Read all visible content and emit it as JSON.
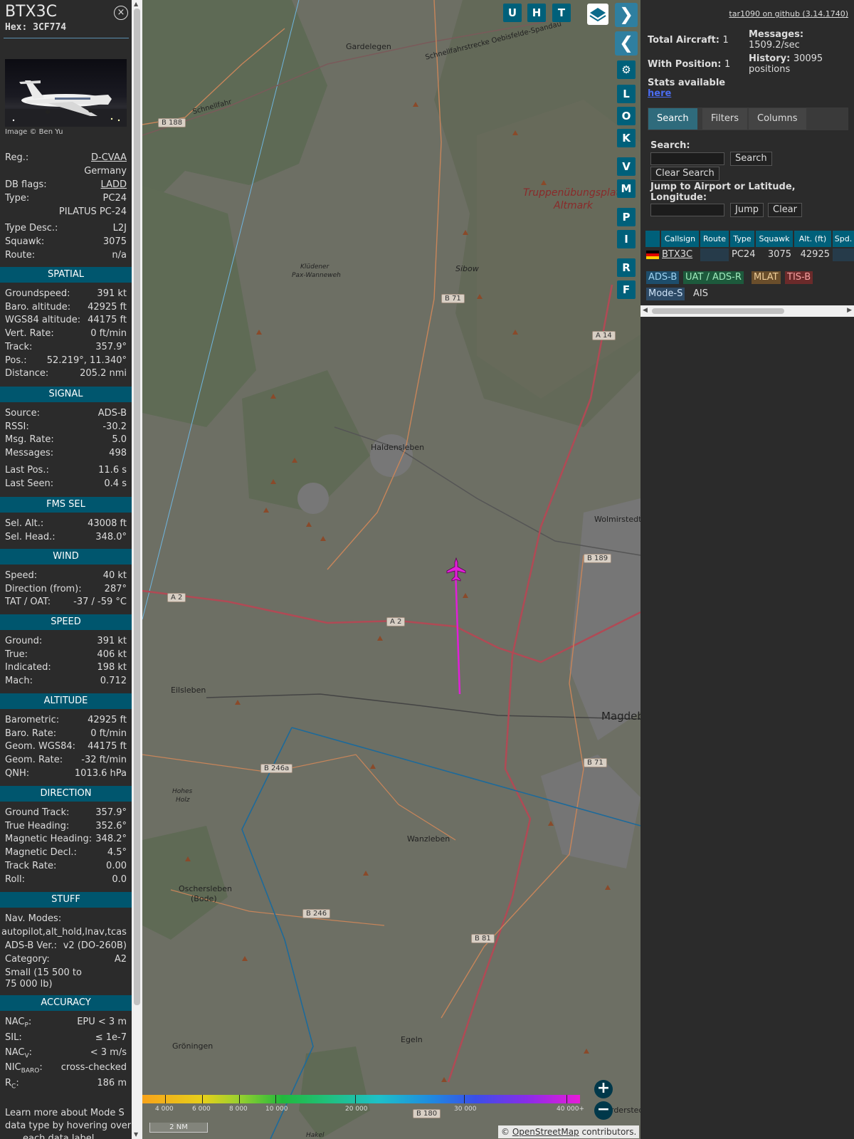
{
  "aircraft": {
    "title": "BTX3C",
    "hex": "Hex: 3CF774",
    "image_credit": "Image © Ben Yu",
    "close": "×"
  },
  "info": {
    "reg_label": "Reg.:",
    "reg_value": "D-CVAA",
    "country": "Germany",
    "dbflags_label": "DB flags:",
    "dbflags_value": "LADD",
    "type_label": "Type:",
    "type_value": "PC24",
    "type_name": "PILATUS PC-24",
    "typedesc_label": "Type Desc.:",
    "typedesc_value": "L2J",
    "squawk_label": "Squawk:",
    "squawk_value": "3075",
    "route_label": "Route:",
    "route_value": "n/a"
  },
  "sections": {
    "spatial": "SPATIAL",
    "signal": "SIGNAL",
    "fms": "FMS SEL",
    "wind": "WIND",
    "speed": "SPEED",
    "altitude": "ALTITUDE",
    "direction": "DIRECTION",
    "stuff": "STUFF",
    "accuracy": "ACCURACY"
  },
  "spatial": [
    {
      "k": "Groundspeed:",
      "v": "391 kt"
    },
    {
      "k": "Baro. altitude:",
      "v": "42925 ft"
    },
    {
      "k": "WGS84 altitude:",
      "v": "44175 ft"
    },
    {
      "k": "Vert. Rate:",
      "v": "0 ft/min"
    },
    {
      "k": "Track:",
      "v": "357.9°"
    },
    {
      "k": "Pos.:",
      "v": "52.219°, 11.340°"
    },
    {
      "k": "Distance:",
      "v": "205.2 nmi"
    }
  ],
  "signal": [
    {
      "k": "Source:",
      "v": "ADS-B"
    },
    {
      "k": "RSSI:",
      "v": "-30.2"
    },
    {
      "k": "Msg. Rate:",
      "v": "5.0"
    },
    {
      "k": "Messages:",
      "v": "498"
    },
    {
      "k": "Last Pos.:",
      "v": "11.6 s"
    },
    {
      "k": "Last Seen:",
      "v": "0.4 s"
    }
  ],
  "fms": [
    {
      "k": "Sel. Alt.:",
      "v": "43008 ft"
    },
    {
      "k": "Sel. Head.:",
      "v": "348.0°"
    }
  ],
  "wind": [
    {
      "k": "Speed:",
      "v": "40 kt"
    },
    {
      "k": "Direction (from):",
      "v": "287°"
    },
    {
      "k": "TAT / OAT:",
      "v": "-37 / -59 °C"
    }
  ],
  "speed": [
    {
      "k": "Ground:",
      "v": "391 kt"
    },
    {
      "k": "True:",
      "v": "406 kt"
    },
    {
      "k": "Indicated:",
      "v": "198 kt"
    },
    {
      "k": "Mach:",
      "v": "0.712"
    }
  ],
  "altitude": [
    {
      "k": "Barometric:",
      "v": "42925 ft"
    },
    {
      "k": "Baro. Rate:",
      "v": "0 ft/min"
    },
    {
      "k": "Geom. WGS84:",
      "v": "44175 ft"
    },
    {
      "k": "Geom. Rate:",
      "v": "-32 ft/min"
    },
    {
      "k": "QNH:",
      "v": "1013.6 hPa"
    }
  ],
  "direction": [
    {
      "k": "Ground Track:",
      "v": "357.9°"
    },
    {
      "k": "True Heading:",
      "v": "352.6°"
    },
    {
      "k": "Magnetic Heading:",
      "v": "348.2°"
    },
    {
      "k": "Magnetic Decl.:",
      "v": "4.5°"
    },
    {
      "k": "Track Rate:",
      "v": "0.00"
    },
    {
      "k": "Roll:",
      "v": "0.0"
    }
  ],
  "stuff": {
    "navmodes_label": "Nav. Modes:",
    "navmodes_value": "autopilot,alt_hold,lnav,tcas",
    "adsbver_label": "ADS-B Ver.:",
    "adsbver_value": "v2 (DO-260B)",
    "category_label": "Category:",
    "category_value": "A2",
    "category_desc_1": "Small (15 500 to",
    "category_desc_2": "75 000 lb)"
  },
  "accuracy": [
    {
      "k": "NAC",
      "sub": "P",
      "tail": ":",
      "v": "EPU < 3 m"
    },
    {
      "k": "SIL:",
      "sub": "",
      "tail": "",
      "v": "≤ 1e-7"
    },
    {
      "k": "NAC",
      "sub": "V",
      "tail": ":",
      "v": "< 3 m/s"
    },
    {
      "k": "NIC",
      "sub": "BARO",
      "tail": ":",
      "v": "cross-checked"
    },
    {
      "k": "R",
      "sub": "C",
      "tail": ":",
      "v": "186 m"
    }
  ],
  "learn_more": [
    "Learn more about Mode S",
    "data type by hovering over",
    "each data label"
  ],
  "map": {
    "toolbar": [
      "U",
      "H",
      "T"
    ],
    "side_buttons": [
      "L",
      "O",
      "K",
      "V",
      "M",
      "P",
      "I",
      "R",
      "F"
    ],
    "place_labels": [
      {
        "t": "Gardelegen"
      },
      {
        "t": "Haldensleben"
      },
      {
        "t": "Truppenübungsplatz"
      },
      {
        "t": "Altmark"
      },
      {
        "t": "Sibow"
      },
      {
        "t": "Klüdener"
      },
      {
        "t": "Pax-Wanneweh"
      },
      {
        "t": "Schnellfahr"
      },
      {
        "t": "Schnellfahrstrecke Oebisfelde-Spandau"
      },
      {
        "t": "Wolmirstedt"
      },
      {
        "t": "Eilsleben"
      },
      {
        "t": "Magdeb"
      },
      {
        "t": "Wanzleben"
      },
      {
        "t": "Hohes"
      },
      {
        "t": "Holz"
      },
      {
        "t": "Oschersleben"
      },
      {
        "t": "(Bode)"
      },
      {
        "t": "Gröningen"
      },
      {
        "t": "Egeln"
      },
      {
        "t": "rdersted"
      },
      {
        "t": "Hakel"
      }
    ],
    "road_badges": [
      "B 188",
      "B 71",
      "A 14",
      "B 189",
      "A 2",
      "A 2",
      "B 246a",
      "B 71",
      "B 246",
      "B 81",
      "B 180"
    ],
    "colorbar_labels": [
      "4 000",
      "6 000",
      "8 000",
      "10 000",
      "20 000",
      "30 000",
      "40 000+"
    ],
    "scale": "2 NM",
    "attribution_symbol": "©",
    "attribution_link": "OpenStreetMap",
    "attribution_tail": "contributors.",
    "zoom_in": "+",
    "zoom_out": "−"
  },
  "right": {
    "github": "tar1090 on github (3.14.1740)",
    "total_label": "Total Aircraft:",
    "total_value": "1",
    "withpos_label": "With Position:",
    "withpos_value": "1",
    "messages_label": "Messages:",
    "messages_value": "1509.2/sec",
    "history_label": "History:",
    "history_value": "30095",
    "history_unit": "positions",
    "stats_text": "Stats available",
    "stats_link": "here",
    "tabs": [
      "Search",
      "Filters",
      "Columns"
    ],
    "search_label": "Search:",
    "search_button": "Search",
    "clear_search_button": "Clear Search",
    "jump_label_1": "Jump to Airport or Latitude,",
    "jump_label_2": "Longitude:",
    "jump_button": "Jump",
    "clear_button": "Clear",
    "columns": [
      "Callsign",
      "Route",
      "Type",
      "Squawk",
      "Alt. (ft)",
      "Spd."
    ],
    "row": {
      "callsign": "BTX3C",
      "route": "",
      "type": "PC24",
      "squawk": "3075",
      "alt": "42925"
    },
    "sources": [
      {
        "t": "ADS-B",
        "bg": "#1d4d6b",
        "fg": "#9fd3f0"
      },
      {
        "t": "UAT / ADS-R",
        "bg": "#1d5a3c",
        "fg": "#9ee8bb"
      },
      {
        "t": "MLAT",
        "bg": "#6a4e2b",
        "fg": "#f0cf9a"
      },
      {
        "t": "TIS-B",
        "bg": "#6b2a2a",
        "fg": "#f5a0a0"
      },
      {
        "t": "Mode-S",
        "bg": "#2d4a66",
        "fg": "#cfe3f7"
      },
      {
        "t": "AIS",
        "bg": "#2b2b2b",
        "fg": "#dddddd"
      }
    ]
  },
  "colors": {
    "accent": "#00607a",
    "track": "#e020d8",
    "panel": "#2b2b2b"
  }
}
